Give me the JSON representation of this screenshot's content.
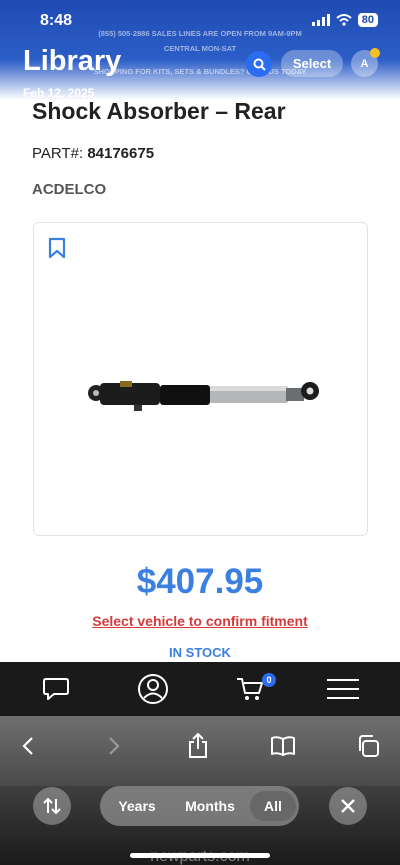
{
  "status": {
    "time": "8:48",
    "battery": "80"
  },
  "banner": {
    "line1": "(855) 505-2886 SALES LINES ARE OPEN FROM 9AM-9PM",
    "line2": "CENTRAL MON-SAT",
    "line3": "SHOPPING FOR KITS, SETS & BUNDLES? CALL US TODAY"
  },
  "library": {
    "title": "Library",
    "date": "Feb 12, 2025",
    "select_label": "Select",
    "avatar_initial": "A"
  },
  "product": {
    "title": "Shock Absorber – Rear",
    "part_label": "PART#:",
    "part_number": "84176675",
    "brand": "ACDELCO",
    "price": "$407.95",
    "fitment_link": "Select vehicle to confirm fitment",
    "stock_status": "IN STOCK"
  },
  "site_nav": {
    "items": [
      "chat-icon",
      "account-icon",
      "cart-icon",
      "menu-icon"
    ],
    "cart_count": "0"
  },
  "safari": {
    "icons": [
      "back-icon",
      "forward-icon",
      "share-icon",
      "bookmarks-icon",
      "tabs-icon"
    ],
    "url": "newparts.com"
  },
  "photos_filter": {
    "options": [
      "Years",
      "Months",
      "All"
    ],
    "selected": "All"
  },
  "colors": {
    "accent_blue": "#3b7fe0",
    "alert_red": "#d63a3a",
    "nav_dark": "#1a1a1a"
  }
}
